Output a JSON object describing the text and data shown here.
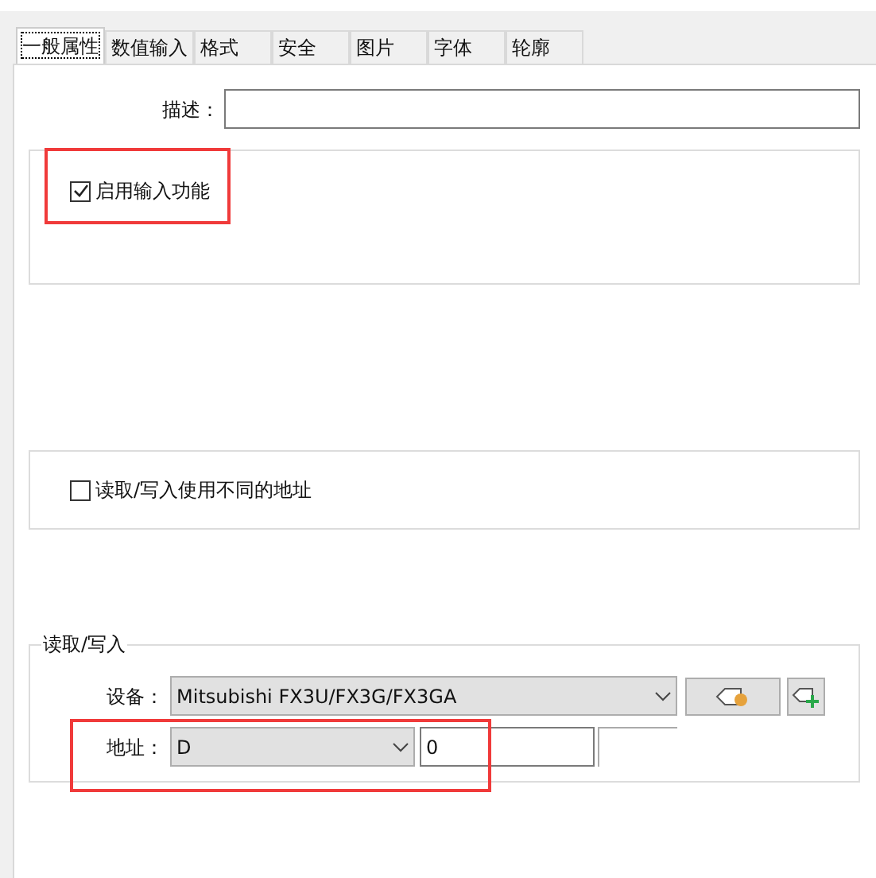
{
  "tabs": [
    {
      "label": "一般属性",
      "selected": true
    },
    {
      "label": "数值输入",
      "selected": false
    },
    {
      "label": "格式",
      "selected": false
    },
    {
      "label": "安全",
      "selected": false
    },
    {
      "label": "图片",
      "selected": false
    },
    {
      "label": "字体",
      "selected": false
    },
    {
      "label": "轮廓",
      "selected": false
    }
  ],
  "description": {
    "label": "描述："
  },
  "enable_input": {
    "label": "启用输入功能",
    "checked": true
  },
  "different_addresses": {
    "label": "读取/写入使用不同的地址",
    "checked": false
  },
  "read_write": {
    "title": "读取/写入",
    "device_label": "设备：",
    "device": "Mitsubishi FX3U/FX3G/FX3GA",
    "address_label": "地址：",
    "address_type": "D",
    "address": "0"
  }
}
